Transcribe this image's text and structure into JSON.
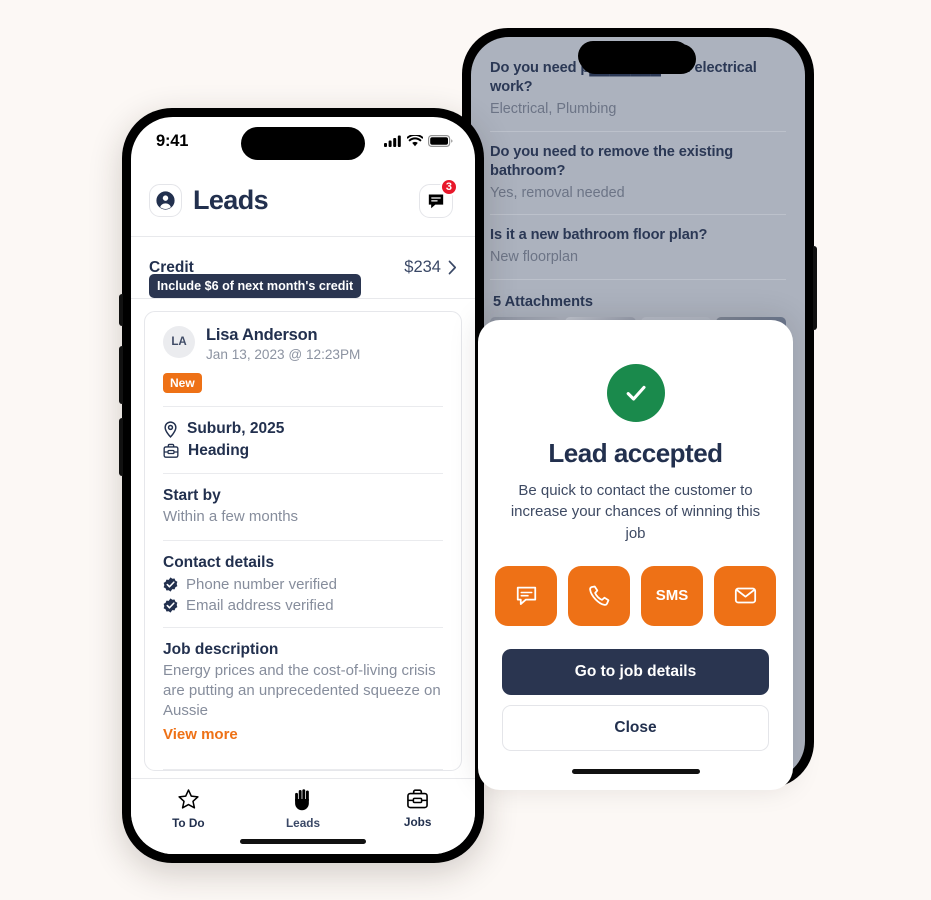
{
  "background_phone": {
    "questions": [
      {
        "question": "Do you need p███████ and electrical work?",
        "answer": "Electrical, Plumbing"
      },
      {
        "question": "Do you need to remove the existing bathroom?",
        "answer": "Yes, removal needed"
      },
      {
        "question": "Is it a new bathroom floor plan?",
        "answer": "New floorplan"
      }
    ],
    "attachments_title": "5 Attachments"
  },
  "front_phone": {
    "status_bar": {
      "time": "9:41",
      "cellular_icon": "signal-bars-icon",
      "wifi_icon": "wifi-icon",
      "battery_icon": "battery-icon"
    },
    "header": {
      "avatar_icon": "person-icon",
      "title": "Leads",
      "chat_icon": "chat-bubble-icon",
      "chat_badge_count": "3"
    },
    "credit": {
      "label": "Credit",
      "amount": "$234",
      "chevron_icon": "chevron-right-icon",
      "tooltip": "Include $6 of next month's credit"
    },
    "lead_card": {
      "initials": "LA",
      "name": "Lisa Anderson",
      "date": "Jan 13, 2023 @ 12:23PM",
      "status_badge": "New",
      "location_icon": "map-pin-icon",
      "location": "Suburb, 2025",
      "heading_icon": "toolbox-icon",
      "heading": "Heading",
      "start_by_label": "Start by",
      "start_by_value": "Within a few months",
      "contact_label": "Contact details",
      "verifications": [
        {
          "icon": "verified-check-icon",
          "text": "Phone number verified"
        },
        {
          "icon": "verified-check-icon",
          "text": "Email address verified"
        }
      ],
      "job_label": "Job description",
      "job_text": "Energy prices and the cost-of-living crisis are putting an unprecedented squeeze on Aussie",
      "view_more": "View more"
    },
    "tabs": [
      {
        "icon": "star-icon",
        "label": "To Do",
        "active": false
      },
      {
        "icon": "hand-icon",
        "label": "Leads",
        "active": true
      },
      {
        "icon": "briefcase-icon",
        "label": "Jobs",
        "active": false
      }
    ]
  },
  "modal": {
    "success_icon": "check-circle-icon",
    "title": "Lead accepted",
    "subtitle": "Be quick to contact the customer to increase your chances of winning this job",
    "actions": [
      {
        "icon": "chat-bubble-icon",
        "label": ""
      },
      {
        "icon": "phone-icon",
        "label": ""
      },
      {
        "icon": "sms-text-icon",
        "label": "SMS"
      },
      {
        "icon": "envelope-icon",
        "label": ""
      }
    ],
    "primary_button": "Go to job details",
    "secondary_button": "Close"
  },
  "colors": {
    "accent_orange": "#EE7116",
    "navy": "#22304E",
    "success_green": "#1A8A4C",
    "badge_red": "#E8182B",
    "page_background": "#FCF8F5"
  }
}
